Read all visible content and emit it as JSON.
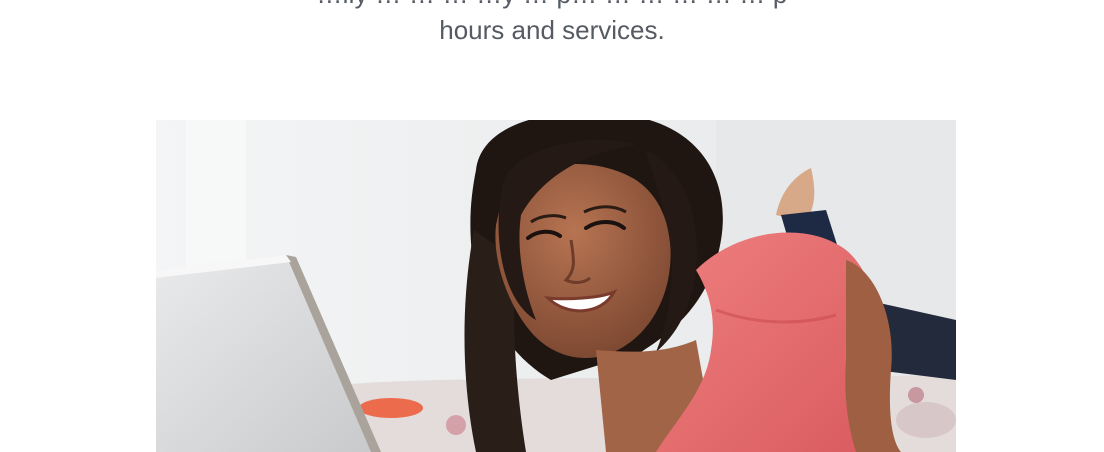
{
  "intro": {
    "line_1": "…ily … … … …y … p… … … … … … p",
    "line_2": "hours and services."
  },
  "hero": {
    "subject": "smiling-woman-using-laptop-photo"
  }
}
